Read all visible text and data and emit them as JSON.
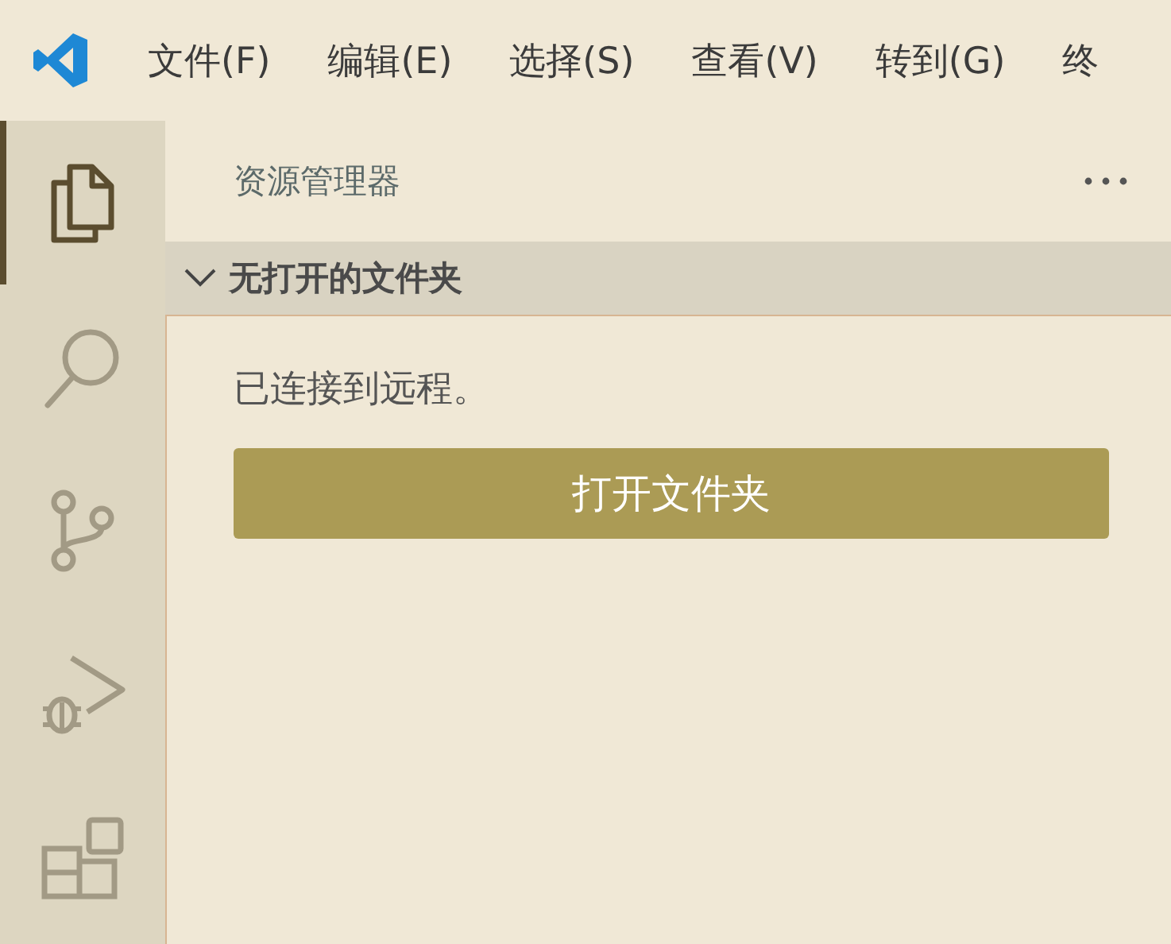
{
  "menu": [
    "文件(F)",
    "编辑(E)",
    "选择(S)",
    "查看(V)",
    "转到(G)",
    "终"
  ],
  "activity_bar": [
    {
      "kind": "explorer",
      "selected": true
    },
    {
      "kind": "search",
      "selected": false
    },
    {
      "kind": "source-control",
      "selected": false
    },
    {
      "kind": "run-debug",
      "selected": false
    },
    {
      "kind": "extensions",
      "selected": false
    }
  ],
  "sidebar": {
    "title": "资源管理器",
    "section": {
      "title": "无打开的文件夹",
      "expanded": true
    },
    "message": "已连接到远程。",
    "button": "打开文件夹"
  }
}
